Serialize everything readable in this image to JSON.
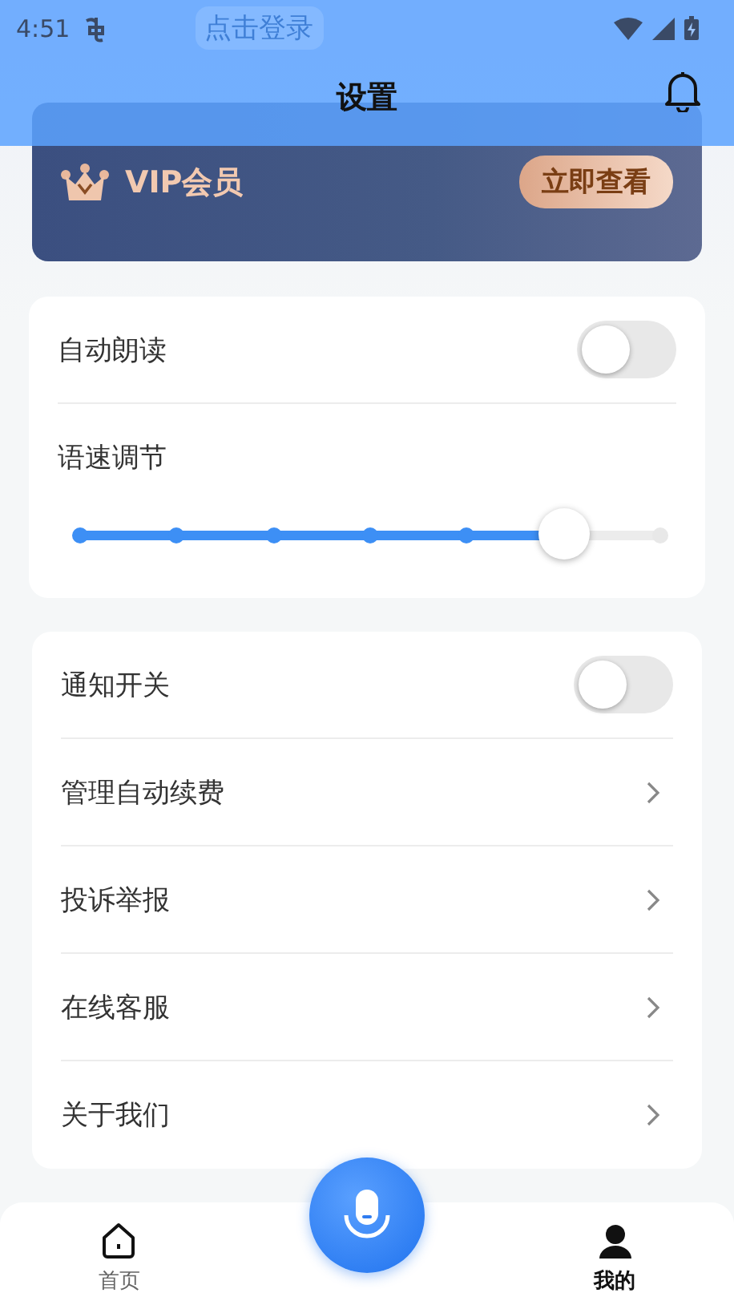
{
  "status_bar": {
    "time": "4:51"
  },
  "login_button": {
    "label": "点击登录"
  },
  "header": {
    "title": "设置"
  },
  "vip_card": {
    "title": "VIP会员",
    "button": "立即查看"
  },
  "settings_groups": [
    {
      "items": [
        {
          "kind": "toggle",
          "label": "自动朗读",
          "on": false
        },
        {
          "kind": "slider",
          "label": "语速调节",
          "level": 0.833
        }
      ]
    },
    {
      "items": [
        {
          "kind": "toggle",
          "label": "通知开关",
          "on": false
        },
        {
          "kind": "link",
          "label": "管理自动续费"
        },
        {
          "kind": "link",
          "label": "投诉举报"
        },
        {
          "kind": "link",
          "label": "在线客服"
        },
        {
          "kind": "link",
          "label": "关于我们"
        }
      ]
    }
  ],
  "bottom_nav": [
    {
      "kind": "home",
      "label": "首页",
      "selected": false
    },
    {
      "kind": "mic"
    },
    {
      "kind": "profile",
      "label": "我的",
      "selected": true
    }
  ]
}
